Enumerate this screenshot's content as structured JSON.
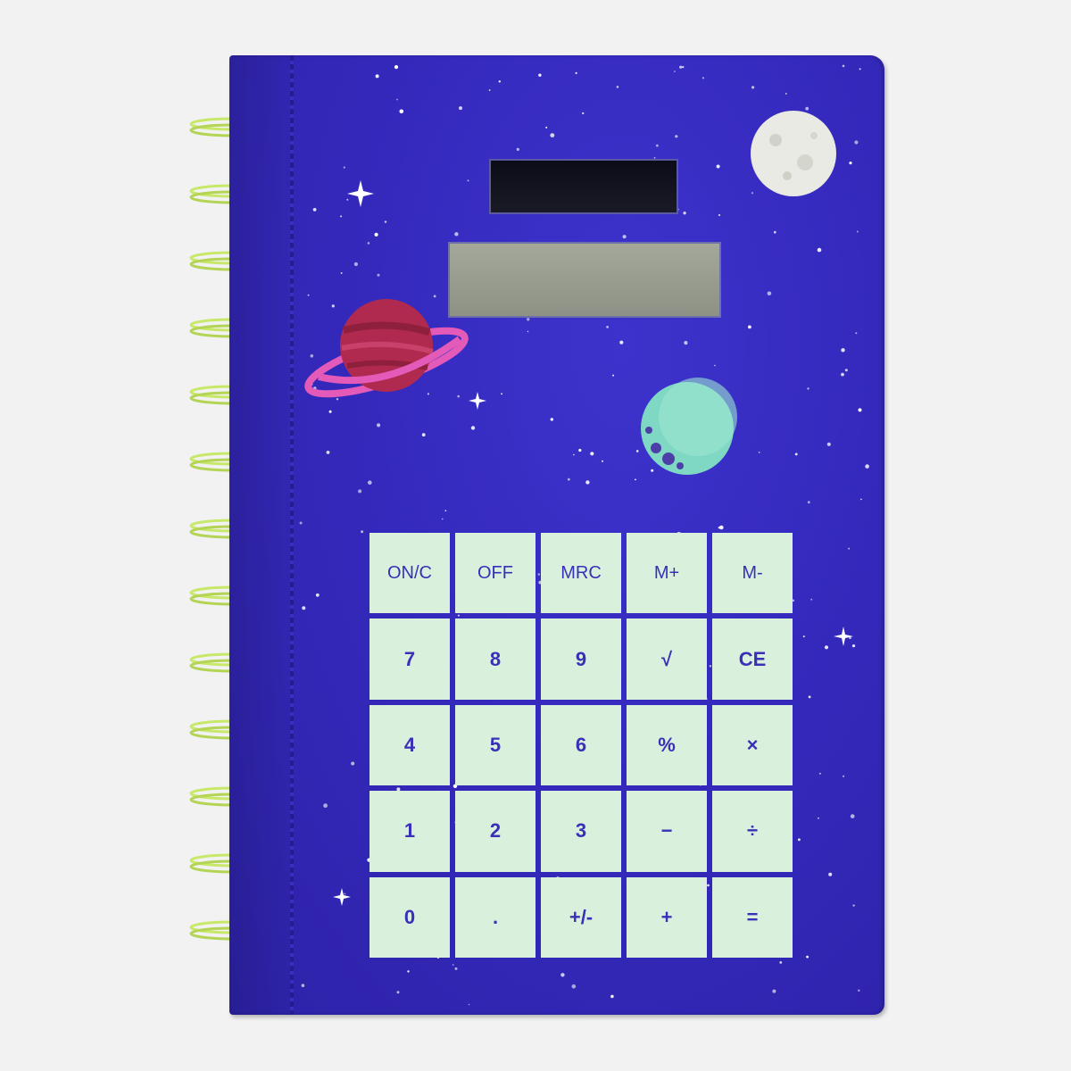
{
  "product": {
    "display_value": "",
    "colors": {
      "cover": "#3529bd",
      "key_face": "#d9f0dc",
      "key_text": "#3a2fb8",
      "spiral": "#c8e86a",
      "background": "#f2f2f2"
    }
  },
  "decorations": {
    "moon": "moon-icon",
    "ringed_planet": "ringed-planet-icon",
    "teal_planet": "teal-planet-icon",
    "sparkle": "sparkle-icon"
  },
  "keypad": {
    "rows": [
      [
        {
          "label": "ON/C",
          "name": "on-clear-key"
        },
        {
          "label": "OFF",
          "name": "off-key"
        },
        {
          "label": "MRC",
          "name": "memory-recall-key"
        },
        {
          "label": "M+",
          "name": "memory-plus-key"
        },
        {
          "label": "M-",
          "name": "memory-minus-key"
        }
      ],
      [
        {
          "label": "7",
          "name": "key-7"
        },
        {
          "label": "8",
          "name": "key-8"
        },
        {
          "label": "9",
          "name": "key-9"
        },
        {
          "label": "√",
          "name": "square-root-key"
        },
        {
          "label": "CE",
          "name": "clear-entry-key"
        }
      ],
      [
        {
          "label": "4",
          "name": "key-4"
        },
        {
          "label": "5",
          "name": "key-5"
        },
        {
          "label": "6",
          "name": "key-6"
        },
        {
          "label": "%",
          "name": "percent-key"
        },
        {
          "label": "×",
          "name": "multiply-key"
        }
      ],
      [
        {
          "label": "1",
          "name": "key-1"
        },
        {
          "label": "2",
          "name": "key-2"
        },
        {
          "label": "3",
          "name": "key-3"
        },
        {
          "label": "−",
          "name": "subtract-key"
        },
        {
          "label": "÷",
          "name": "divide-key"
        }
      ],
      [
        {
          "label": "0",
          "name": "key-0"
        },
        {
          "label": ".",
          "name": "decimal-key"
        },
        {
          "label": "+/-",
          "name": "sign-toggle-key"
        },
        {
          "label": "+",
          "name": "add-key"
        },
        {
          "label": "=",
          "name": "equals-key"
        }
      ]
    ]
  }
}
